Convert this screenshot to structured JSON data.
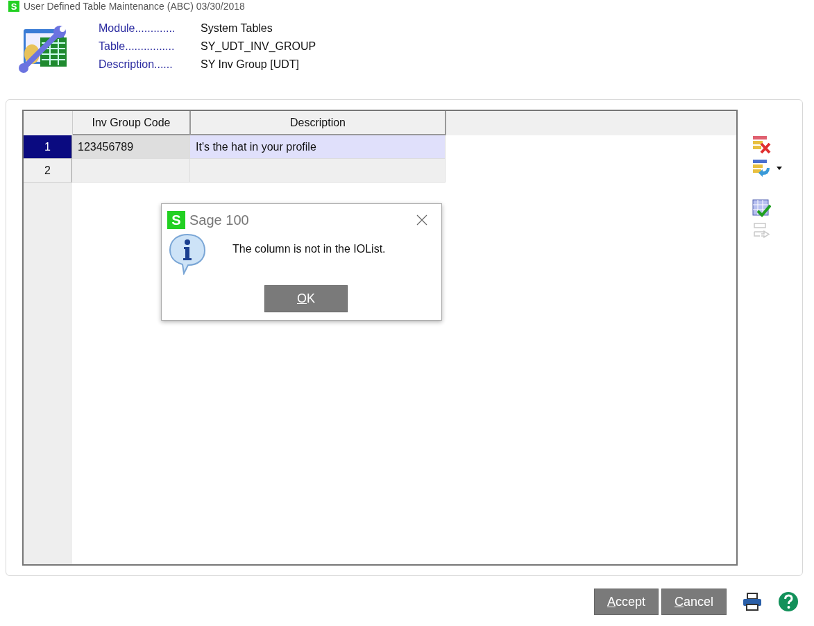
{
  "window": {
    "logo": "S",
    "title": "User Defined Table Maintenance (ABC) 03/30/2018"
  },
  "info": [
    {
      "label": "Module.............",
      "value": "System Tables"
    },
    {
      "label": "Table................",
      "value": "SY_UDT_INV_GROUP"
    },
    {
      "label": "Description......",
      "value": "SY Inv Group  [UDT]"
    }
  ],
  "grid": {
    "columns": [
      "Inv Group Code",
      "Description"
    ],
    "rows": [
      {
        "number": "1",
        "selected": true,
        "cells": [
          "123456789",
          "It's the hat in your profile"
        ]
      },
      {
        "number": "2",
        "selected": false,
        "cells": [
          "",
          ""
        ]
      }
    ]
  },
  "toolbar": [
    {
      "kind": "delete",
      "disabled": false
    },
    {
      "kind": "insert",
      "disabled": false,
      "dropdown": true
    },
    {
      "kind": "validate",
      "disabled": false
    },
    {
      "kind": "move",
      "disabled": true
    }
  ],
  "dialog": {
    "title": "Sage 100",
    "logo": "S",
    "message": "The column is not in the IOList.",
    "button": "OK"
  },
  "footer": {
    "buttons": [
      "Accept",
      "Cancel"
    ]
  }
}
